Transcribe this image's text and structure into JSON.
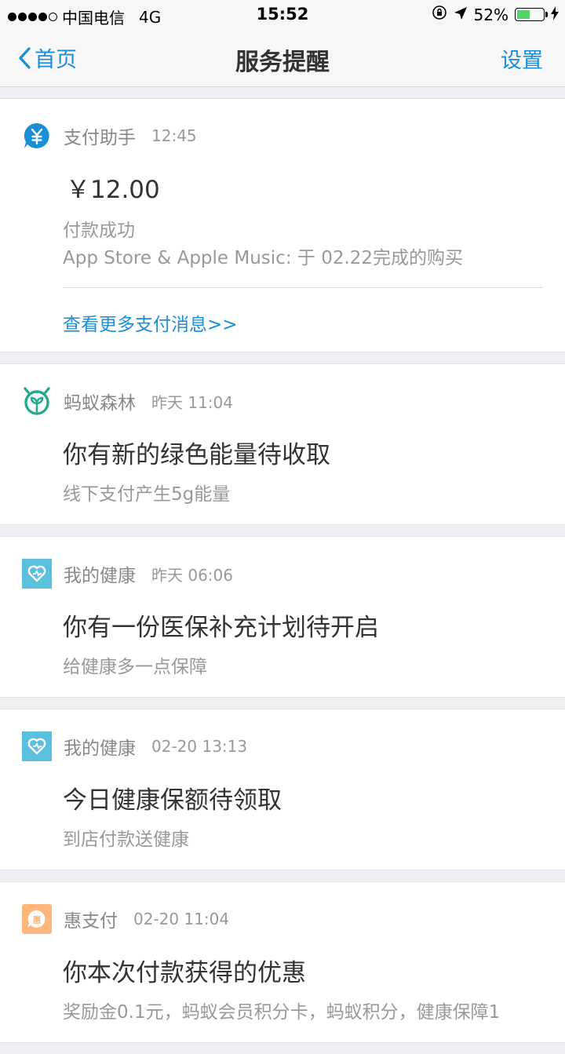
{
  "status_bar": {
    "carrier": "中国电信",
    "network": "4G",
    "time": "15:52",
    "battery": "52%",
    "battery_level": 0.52
  },
  "nav": {
    "back_label": "首页",
    "title": "服务提醒",
    "settings_label": "设置"
  },
  "cards": [
    {
      "app": "支付助手",
      "time": "12:45",
      "icon": "yuan-icon",
      "amount": "￥12.00",
      "line1": "付款成功",
      "line2": "App Store & Apple Music: 于 02.22完成的购买",
      "more": "查看更多支付消息>>"
    },
    {
      "app": "蚂蚁森林",
      "time": "昨天 11:04",
      "icon": "sprout-icon",
      "title": "你有新的绿色能量待收取",
      "sub": "线下支付产生5g能量"
    },
    {
      "app": "我的健康",
      "time": "昨天 06:06",
      "icon": "heart-icon",
      "title": "你有一份医保补充计划待开启",
      "sub": "给健康多一点保障"
    },
    {
      "app": "我的健康",
      "time": "02-20 13:13",
      "icon": "heart-icon",
      "title": "今日健康保额待领取",
      "sub": "到店付款送健康"
    },
    {
      "app": "惠支付",
      "time": "02-20 11:04",
      "icon": "discount-icon",
      "title": "你本次付款获得的优惠",
      "sub": "奖励金0.1元，蚂蚁会员积分卡，蚂蚁积分，健康保障1"
    }
  ],
  "colors": {
    "accent": "#1a8fd6",
    "forest": "#2aa88e",
    "health": "#5bc0de",
    "discount": "#ffb67a"
  }
}
